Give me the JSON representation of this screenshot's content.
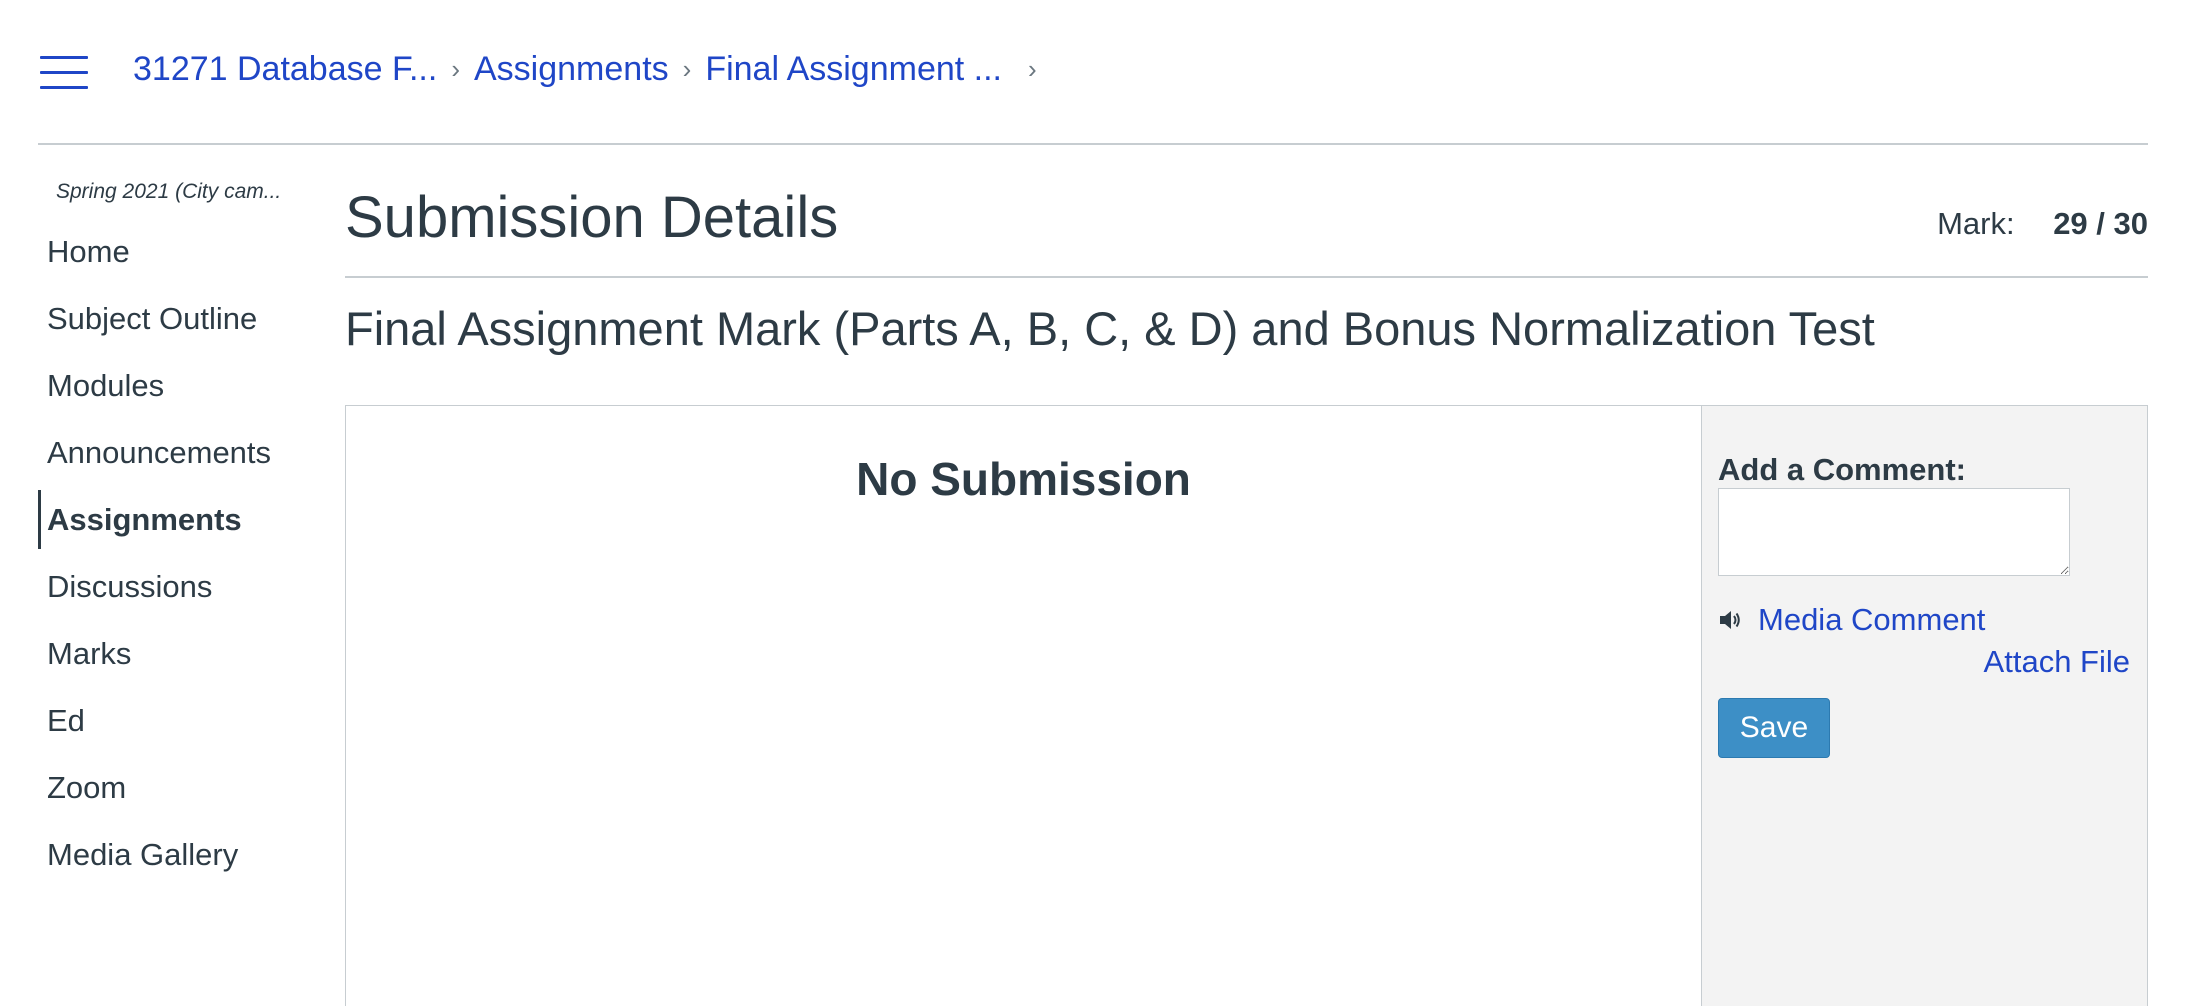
{
  "breadcrumb": {
    "items": [
      "31271 Database F...",
      "Assignments",
      "Final Assignment ..."
    ],
    "separator": "›"
  },
  "sidebar": {
    "term": "Spring 2021 (City cam...",
    "items": [
      {
        "label": "Home"
      },
      {
        "label": "Subject Outline"
      },
      {
        "label": "Modules"
      },
      {
        "label": "Announcements"
      },
      {
        "label": "Assignments",
        "active": true
      },
      {
        "label": "Discussions"
      },
      {
        "label": "Marks"
      },
      {
        "label": "Ed"
      },
      {
        "label": "Zoom"
      },
      {
        "label": "Media Gallery"
      }
    ]
  },
  "main": {
    "page_title": "Submission Details",
    "mark_label": "Mark:",
    "mark_value": "29 / 30",
    "assignment_title": "Final Assignment Mark (Parts A, B, C, & D) and Bonus Normalization Test",
    "submission_status": "No Submission"
  },
  "comments": {
    "label": "Add a Comment:",
    "media_comment": "Media Comment",
    "attach_file": "Attach File",
    "save_label": "Save"
  },
  "icons": {
    "menu": "hamburger-menu-icon",
    "speaker": "speaker-icon"
  },
  "colors": {
    "link": "#1f46c7",
    "text": "#2d3b45",
    "button": "#3d8fc6",
    "comment_bg": "#f3f3f3"
  }
}
